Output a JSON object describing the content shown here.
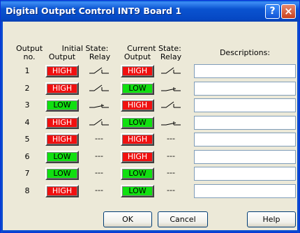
{
  "window": {
    "title": "Digital Output Control INT9 Board 1",
    "help_glyph": "?",
    "close_glyph": "×"
  },
  "headers": {
    "output_no_line1": "Output",
    "output_no_line2": "no.",
    "initial_state": "Initial State:",
    "current_state": "Current State:",
    "output": "Output",
    "relay": "Relay",
    "descriptions": "Descriptions:"
  },
  "rows": [
    {
      "no": "1",
      "initial_output": "HIGH",
      "initial_relay": "open",
      "current_output": "HIGH",
      "current_relay": "open",
      "description": ""
    },
    {
      "no": "2",
      "initial_output": "HIGH",
      "initial_relay": "open",
      "current_output": "LOW",
      "current_relay": "closed",
      "description": ""
    },
    {
      "no": "3",
      "initial_output": "LOW",
      "initial_relay": "closed",
      "current_output": "HIGH",
      "current_relay": "open",
      "description": ""
    },
    {
      "no": "4",
      "initial_output": "HIGH",
      "initial_relay": "open",
      "current_output": "LOW",
      "current_relay": "closed",
      "description": ""
    },
    {
      "no": "5",
      "initial_output": "HIGH",
      "initial_relay": "---",
      "current_output": "HIGH",
      "current_relay": "---",
      "description": ""
    },
    {
      "no": "6",
      "initial_output": "LOW",
      "initial_relay": "---",
      "current_output": "HIGH",
      "current_relay": "---",
      "description": ""
    },
    {
      "no": "7",
      "initial_output": "LOW",
      "initial_relay": "---",
      "current_output": "LOW",
      "current_relay": "---",
      "description": ""
    },
    {
      "no": "8",
      "initial_output": "HIGH",
      "initial_relay": "---",
      "current_output": "LOW",
      "current_relay": "---",
      "description": ""
    }
  ],
  "buttons": {
    "ok": "OK",
    "cancel": "Cancel",
    "help": "Help"
  },
  "colors": {
    "high": "#f01010",
    "low": "#10e010",
    "titlebar": "#0a53d0"
  }
}
